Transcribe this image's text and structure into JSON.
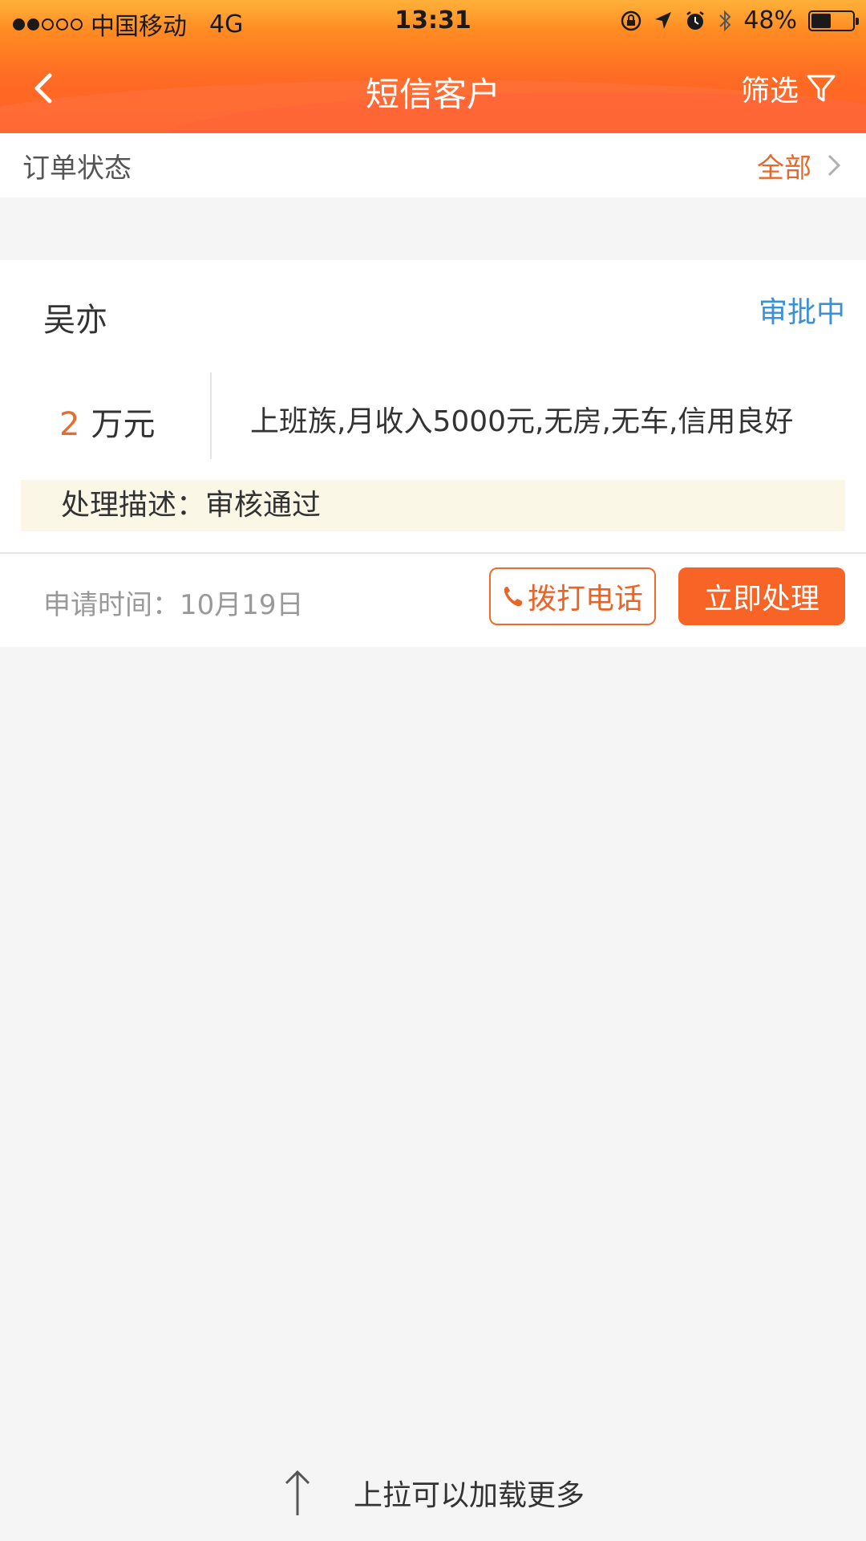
{
  "status_bar": {
    "carrier": "中国移动",
    "network": "4G",
    "time": "13:31",
    "battery": "48%",
    "battery_level": 0.48
  },
  "nav": {
    "title": "短信客户",
    "filter_label": "筛选"
  },
  "order_status": {
    "label": "订单状态",
    "value": "全部"
  },
  "card": {
    "name": "吴亦",
    "state": "审批中",
    "amount_number": "2",
    "amount_unit": "万元",
    "description": "上班族,月收入5000元,无房,无车,信用良好",
    "process_desc": "处理描述：审核通过",
    "apply_time": "申请时间：10月19日",
    "call_label": "拨打电话",
    "process_label": "立即处理"
  },
  "footer": {
    "load_more": "上拉可以加载更多"
  },
  "colors": {
    "header": "#ff6a24",
    "accent": "#f86326",
    "state_blue": "#3d8fd6"
  }
}
